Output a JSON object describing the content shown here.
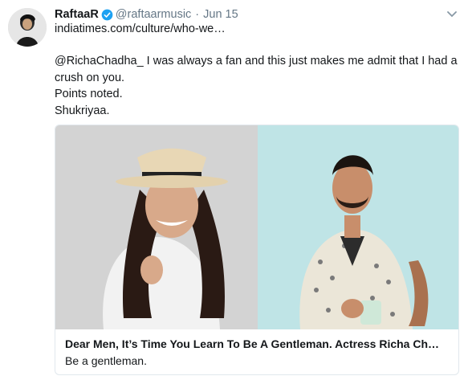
{
  "tweet": {
    "display_name": "RaftaaR",
    "handle": "@raftaarmusic",
    "separator": "·",
    "date": "Jun 15",
    "link_text": "indiatimes.com/culture/who-we…",
    "lines": [
      "@RichaChadha_  I was always a fan and this just makes me admit that I had a crush on you.",
      "Points noted.",
      "Shukriyaa."
    ],
    "icons": {
      "verified": "verified-badge-icon",
      "caret": "chevron-down-icon"
    },
    "colors": {
      "verified": "#1da1f2",
      "meta_gray": "#657786"
    }
  },
  "card": {
    "title": "Dear Men, It’s Time You Learn To Be A Gentleman. Actress Richa Ch…",
    "description": "Be a gentleman."
  }
}
